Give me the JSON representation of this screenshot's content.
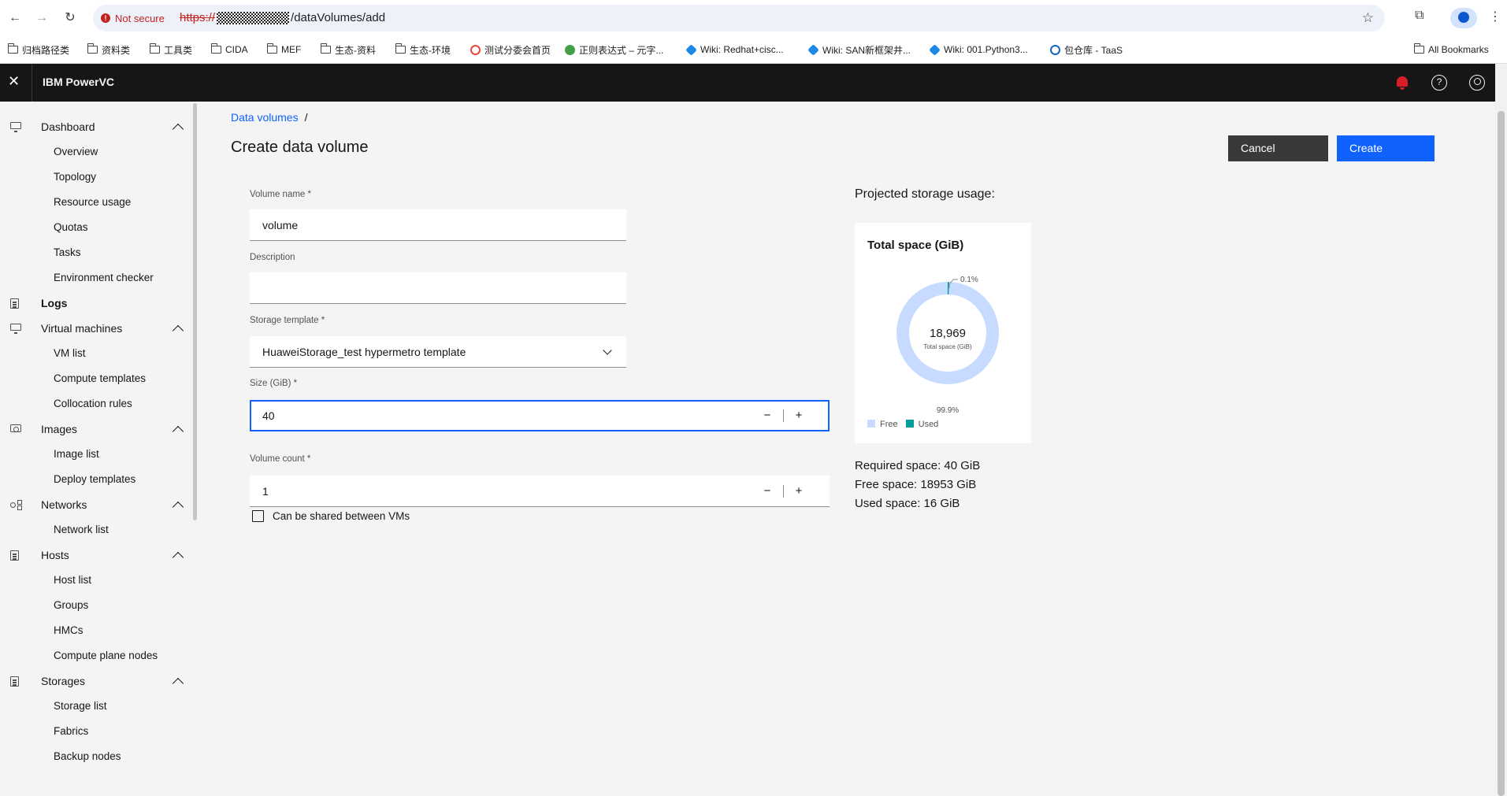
{
  "browser": {
    "security_label": "Not secure",
    "url_scheme": "https://",
    "url_path": "/dataVolumes/add",
    "bookmarks": [
      {
        "label": "归档路径类",
        "type": "folder"
      },
      {
        "label": "资料类",
        "type": "folder"
      },
      {
        "label": "工具类",
        "type": "folder"
      },
      {
        "label": "CIDA",
        "type": "folder"
      },
      {
        "label": "MEF",
        "type": "folder"
      },
      {
        "label": "生态-资料",
        "type": "folder"
      },
      {
        "label": "生态-环境",
        "type": "folder"
      },
      {
        "label": "测试分委会首页",
        "type": "site"
      },
      {
        "label": "正则表达式 – 元字...",
        "type": "site"
      },
      {
        "label": "Wiki: Redhat+cisc...",
        "type": "site"
      },
      {
        "label": "Wiki: SAN新框架井...",
        "type": "site"
      },
      {
        "label": "Wiki: 001.Python3...",
        "type": "site"
      },
      {
        "label": "包仓库 - TaaS",
        "type": "site"
      }
    ],
    "all_bookmarks": "All Bookmarks"
  },
  "app": {
    "brand": "IBM PowerVC"
  },
  "sidebar": {
    "sections": [
      {
        "label": "Dashboard",
        "icon": "monitor-icon",
        "items": [
          "Overview",
          "Topology",
          "Resource usage",
          "Quotas",
          "Tasks",
          "Environment checker"
        ]
      },
      {
        "label": "Logs",
        "icon": "log-icon",
        "items": []
      },
      {
        "label": "Virtual machines",
        "icon": "monitor-icon",
        "items": [
          "VM list",
          "Compute templates",
          "Collocation rules"
        ]
      },
      {
        "label": "Images",
        "icon": "camera-icon",
        "items": [
          "Image list",
          "Deploy templates"
        ]
      },
      {
        "label": "Networks",
        "icon": "network-icon",
        "items": [
          "Network list"
        ]
      },
      {
        "label": "Hosts",
        "icon": "host-icon",
        "items": [
          "Host list",
          "Groups",
          "HMCs",
          "Compute plane nodes"
        ]
      },
      {
        "label": "Storages",
        "icon": "storage-icon",
        "items": [
          "Storage list",
          "Fabrics",
          "Backup nodes"
        ]
      }
    ]
  },
  "main": {
    "breadcrumb": {
      "link": "Data volumes",
      "separator": "/"
    },
    "title": "Create data volume",
    "cancel_label": "Cancel",
    "create_label": "Create",
    "form": {
      "volume_name_label": "Volume name *",
      "volume_name_value": "volume",
      "description_label": "Description",
      "description_value": "",
      "storage_template_label": "Storage template *",
      "storage_template_value": "HuaweiStorage_test hypermetro template",
      "size_label": "Size (GiB) *",
      "size_value": "40",
      "volume_count_label": "Volume count *",
      "volume_count_value": "1",
      "shared_label": "Can be shared between VMs",
      "shared_checked": false,
      "minus": "−",
      "plus": "+"
    },
    "projection": {
      "title": "Projected storage usage:",
      "card_title": "Total space (GiB)",
      "total_value": "18,969",
      "total_caption": "Total space (GiB)",
      "used_pct_label": "0.1%",
      "free_pct_label": "99.9%",
      "legend_free": "Free",
      "legend_used": "Used",
      "free_color": "#c6dbff",
      "used_color": "#009d9a",
      "used_fraction": 0.001,
      "required": "Required space: 40 GiB",
      "free": "Free space: 18953 GiB",
      "used": "Used space: 16 GiB"
    }
  }
}
